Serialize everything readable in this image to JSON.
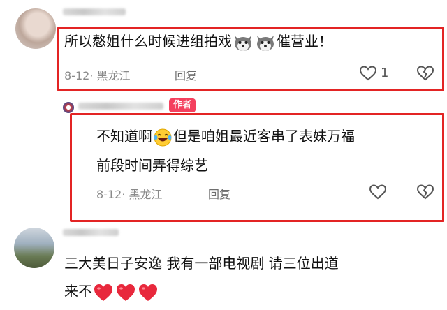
{
  "comments": [
    {
      "text_before": "所以㥿姐什么时候进组拍戏",
      "text_after": "催营业！",
      "meta": "8-12· 黑龙江",
      "reply_label": "回复",
      "likes": "1"
    },
    {
      "author_tag": "作者",
      "line1_before": "不知道啊",
      "line1_after": "但是咱姐最近客串了表妹万福",
      "line2": "前段时间弄得综艺",
      "meta": "8-12· 黑龙江",
      "reply_label": "回复"
    },
    {
      "line1": "三大美日子安逸   我有一部电视剧   请三位出道",
      "line2": "来不"
    }
  ],
  "icons": {
    "like": "heart-outline-icon",
    "dislike": "broken-heart-icon",
    "emoji_dog": "husky-emoji-icon",
    "emoji_laugh": "laughing-tears-emoji-icon",
    "emoji_heart": "red-heart-emoji-icon"
  },
  "colors": {
    "highlight_box": "#e32424",
    "author_tag": "#f4405e",
    "heart_emoji": "#e8283c"
  }
}
